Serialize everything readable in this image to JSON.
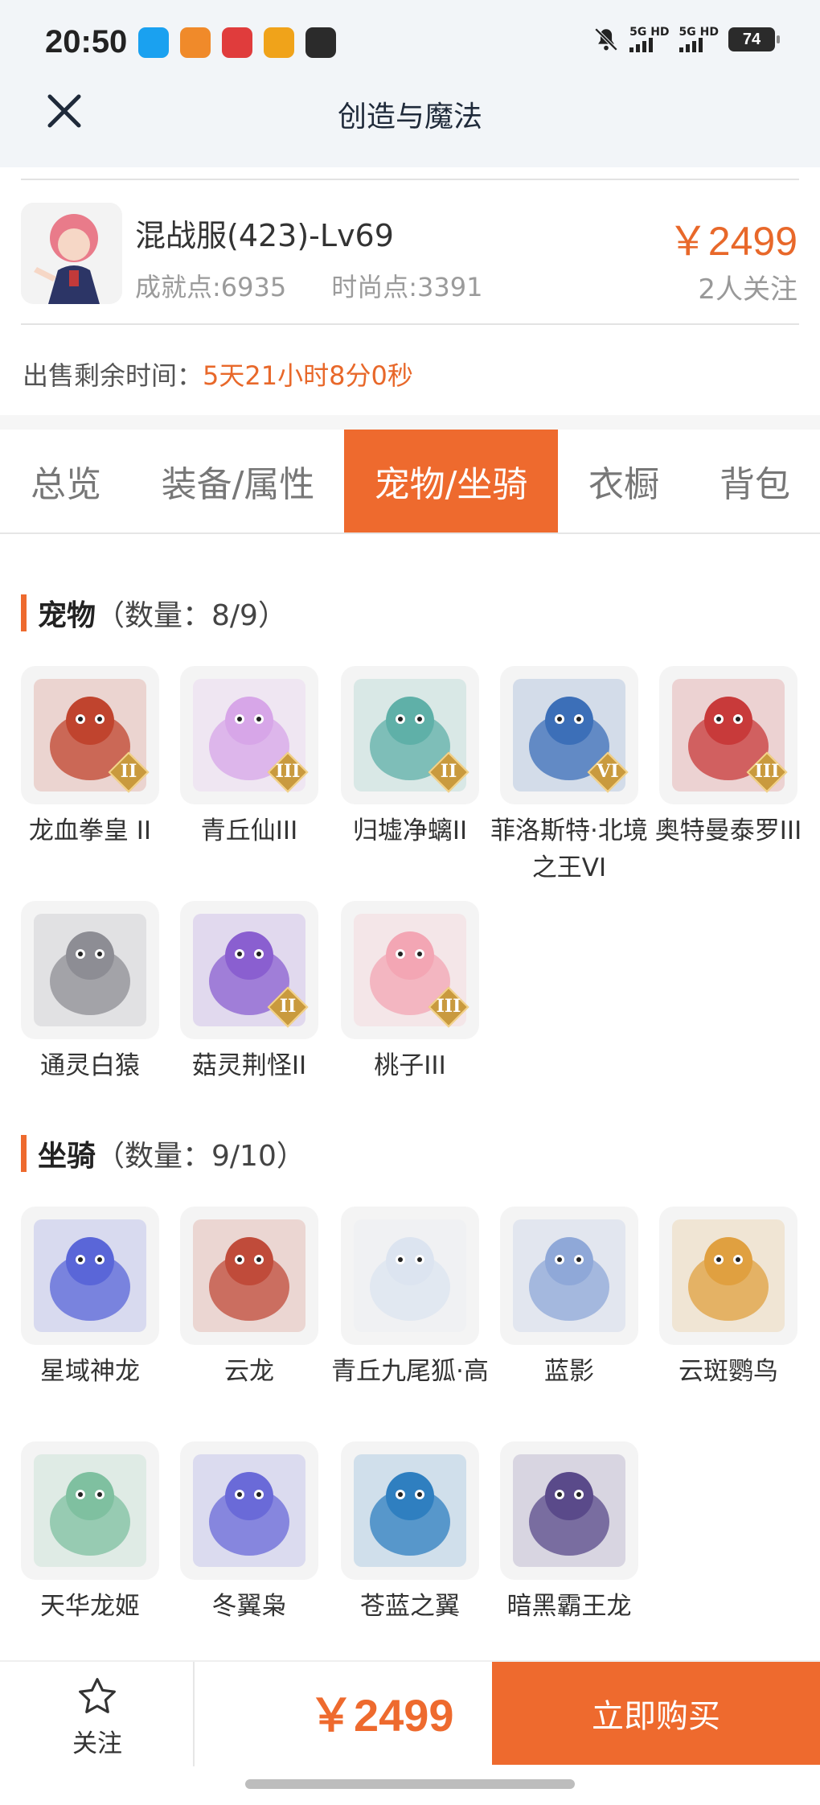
{
  "status_bar": {
    "time": "20:50",
    "net1": "5G HD",
    "net2": "5G HD",
    "battery": "74",
    "app_icons": [
      "qq-icon",
      "store-icon",
      "map-pin-icon",
      "weibo-icon",
      "cat-icon"
    ],
    "app_icon_colors": [
      "#1aa1f0",
      "#f08a2a",
      "#e03c3c",
      "#f0a31a",
      "#2b2b2b"
    ]
  },
  "header": {
    "title": "创造与魔法"
  },
  "listing": {
    "server": "混战服(423)-Lv69",
    "achievement": "成就点:6935",
    "fashion": "时尚点:3391",
    "price": "￥2499",
    "followers": "2人关注",
    "remain_label": "出售剩余时间：",
    "remain_value": "5天21小时8分0秒"
  },
  "tabs": [
    {
      "label": "总览",
      "active": false
    },
    {
      "label": "装备/属性",
      "active": false
    },
    {
      "label": "宠物/坐骑",
      "active": true
    },
    {
      "label": "衣橱",
      "active": false
    },
    {
      "label": "背包",
      "active": false
    }
  ],
  "pets": {
    "title": "宠物",
    "count": "（数量：8/9）",
    "items": [
      {
        "name": "龙血拳皇 II",
        "grade": "II",
        "color": "#c0442e"
      },
      {
        "name": "青丘仙III",
        "grade": "III",
        "color": "#d7a6e8"
      },
      {
        "name": "归墟净螭II",
        "grade": "II",
        "color": "#5fb0a8"
      },
      {
        "name": "菲洛斯特·北境之王VI",
        "grade": "VI",
        "color": "#3c6fb8"
      },
      {
        "name": "奥特曼泰罗III",
        "grade": "III",
        "color": "#c83a3a"
      },
      {
        "name": "通灵白猿",
        "grade": "",
        "color": "#8d8d94"
      },
      {
        "name": "菇灵荆怪II",
        "grade": "II",
        "color": "#8a5fd0"
      },
      {
        "name": "桃子III",
        "grade": "III",
        "color": "#f3a6b4"
      }
    ]
  },
  "mounts": {
    "title": "坐骑",
    "count": "（数量：9/10）",
    "items": [
      {
        "name": "星域神龙",
        "color": "#5a66d8"
      },
      {
        "name": "云龙",
        "color": "#c04b3a"
      },
      {
        "name": "青丘九尾狐·高",
        "color": "#dce4f0"
      },
      {
        "name": "蓝影",
        "color": "#8fa8d8"
      },
      {
        "name": "云斑鹦鸟",
        "color": "#e0a040"
      },
      {
        "name": "天华龙姬",
        "color": "#7fc0a0"
      },
      {
        "name": "冬翼枭",
        "color": "#6a6ad8"
      },
      {
        "name": "苍蓝之翼",
        "color": "#2f7fc0"
      },
      {
        "name": "暗黑霸王龙",
        "color": "#5a4a8a"
      }
    ]
  },
  "bottom_bar": {
    "follow_label": "关注",
    "price": "￥2499",
    "buy_label": "立即购买"
  },
  "colors": {
    "accent": "#ee6a2e",
    "header_bg": "#f2f5f8"
  }
}
